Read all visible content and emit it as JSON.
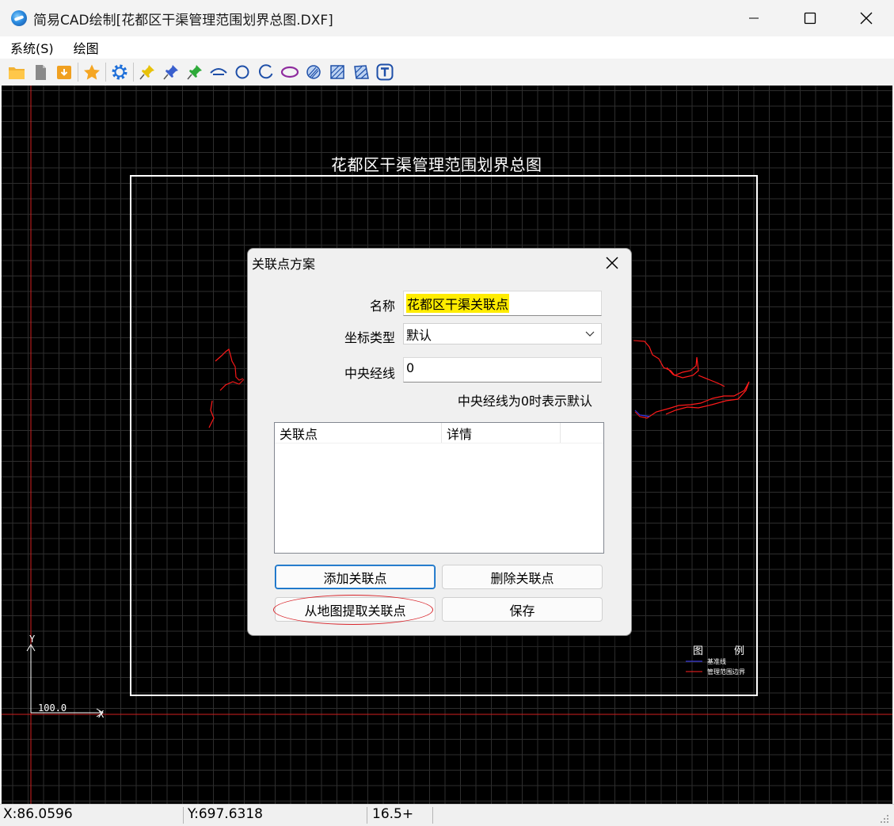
{
  "window": {
    "title": "简易CAD绘制[花都区干渠管理范围划界总图.DXF]"
  },
  "menu": {
    "items": [
      "系统(S)",
      "绘图"
    ]
  },
  "toolbar": {
    "buttons": [
      "open-folder-icon",
      "new-file-icon",
      "import-icon",
      "favorite-star-icon",
      "settings-gear-icon",
      "pin-yellow-icon",
      "pin-blue-icon",
      "pin-green-icon",
      "arc-line-icon",
      "circle-icon",
      "arc-icon",
      "ellipse-icon",
      "hatch-circle-icon",
      "hatch-rect-icon",
      "hatch-polygon-icon",
      "text-icon"
    ]
  },
  "drawing": {
    "title": "花都区干渠管理范围划界总图",
    "axis_y_label": "Y",
    "axis_x_label": "X",
    "scale_label": "100.0",
    "legend": {
      "title_left": "图",
      "title_right": "例",
      "items": [
        "基准线",
        "管理范围边界"
      ],
      "colors": [
        "#3b3bff",
        "#ff2020"
      ]
    }
  },
  "dialog": {
    "title": "关联点方案",
    "name_label": "名称",
    "name_value": "花都区干渠关联点",
    "coord_type_label": "坐标类型",
    "coord_type_value": "默认",
    "meridian_label": "中央经线",
    "meridian_value": "0",
    "meridian_hint": "中央经线为0时表示默认",
    "list_columns": [
      "关联点",
      "详情"
    ],
    "buttons": {
      "add": "添加关联点",
      "delete": "删除关联点",
      "extract": "从地图提取关联点",
      "save": "保存"
    }
  },
  "status": {
    "x": "X:86.0596",
    "y": "Y:697.6318",
    "zoom": "16.5+"
  }
}
